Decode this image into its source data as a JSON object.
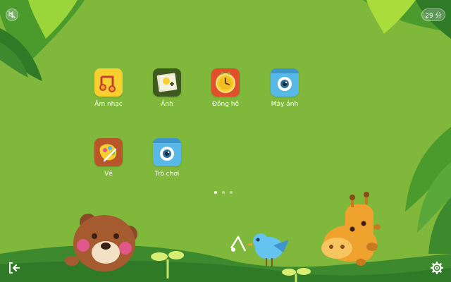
{
  "top_bar": {
    "mute_icon": "speaker-muted-icon",
    "timer_text": "29 分"
  },
  "apps": [
    {
      "label": "Âm nhạc",
      "icon": "music-note-icon",
      "color": "#f7cf2e"
    },
    {
      "label": "Ảnh",
      "icon": "photo-album-icon",
      "color": "#3f5a1e"
    },
    {
      "label": "Đồng hồ",
      "icon": "clock-icon",
      "color": "#e1502a"
    },
    {
      "label": "Máy ảnh",
      "icon": "camera-eye-icon",
      "color": "#58b9e6"
    },
    {
      "label": "Vẽ",
      "icon": "paint-palette-icon",
      "color": "#b8562a"
    },
    {
      "label": "Trò chơi",
      "icon": "game-eye-icon",
      "color": "#58b9e6"
    }
  ],
  "pager": {
    "pages": 3,
    "current": 1
  },
  "bottom_bar": {
    "exit_icon": "exit-door-icon",
    "settings_icon": "gear-icon"
  },
  "colors": {
    "background": "#7fb83a",
    "foliage_dark": "#3d8a2e",
    "foliage_light": "#8fd12e"
  }
}
